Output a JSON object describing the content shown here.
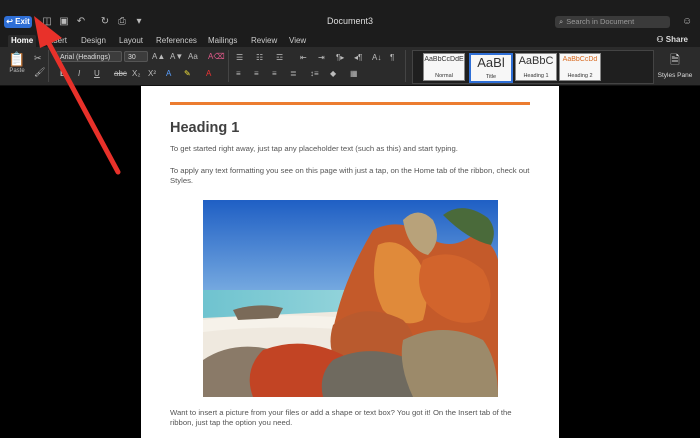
{
  "titlebar": {
    "exit_label": "Exit",
    "document_title": "Document3",
    "search_placeholder": "Search in Document"
  },
  "tabs": [
    "Home",
    "Insert",
    "Design",
    "Layout",
    "References",
    "Mailings",
    "Review",
    "View"
  ],
  "share_label": "Share",
  "ribbon": {
    "paste_label": "Paste",
    "font_name": "Arial (Headings)",
    "font_size": "30",
    "styles": [
      {
        "sample": "AaBbCcDdE",
        "name": "Normal"
      },
      {
        "sample": "AaBl",
        "name": "Title"
      },
      {
        "sample": "AaBbC",
        "name": "Heading 1"
      },
      {
        "sample": "AaBbCcDd",
        "name": "Heading 2"
      }
    ],
    "styles_pane_label": "Styles Pane"
  },
  "document": {
    "heading": "Heading 1",
    "para1": "To get started right away, just tap any placeholder text (such as this) and start typing.",
    "para2": "To apply any text formatting you see on this page with just a tap, on the Home tab of the ribbon, check out Styles.",
    "para3": "Want to insert a picture from your files or add a shape or text box? You got it! On the Insert tab of the ribbon, just tap the option you need."
  },
  "colors": {
    "accent": "#ec7c30",
    "exit_button": "#2f6fd6",
    "annotation_arrow": "#e8312a"
  }
}
